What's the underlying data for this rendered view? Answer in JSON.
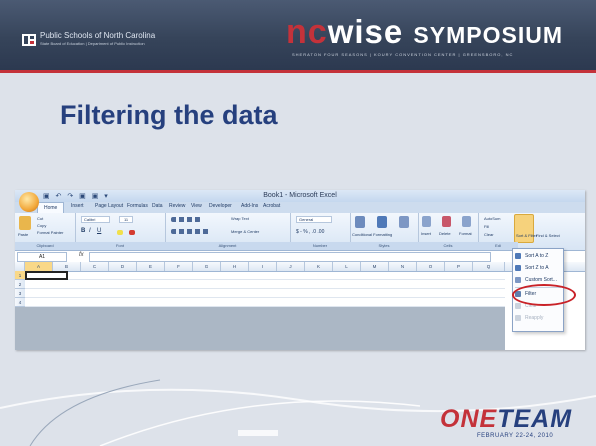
{
  "header": {
    "org_title": "Public Schools of North Carolina",
    "org_subtitle": "State Board of Education | Department of Public Instruction",
    "brand_nc": "nc",
    "brand_wise": "wise",
    "brand_symposium": "SYMPOSIUM",
    "venue": "SHERATON FOUR SEASONS  |  KOURY CONVENTION CENTER  |  GREENSBORO, NC"
  },
  "slide": {
    "title": "Filtering the data"
  },
  "excel": {
    "window_title": "Book1 - Microsoft Excel",
    "quick_access": "▣ ↶ ↷ ▣ ▣ ▾",
    "tabs": [
      "Home",
      "Insert",
      "Page Layout",
      "Formulas",
      "Data",
      "Review",
      "View",
      "Developer",
      "Add-Ins",
      "Acrobat"
    ],
    "ribbon_groups": {
      "clipboard": "Clipboard",
      "font": "Font",
      "alignment": "Alignment",
      "number": "Number",
      "styles": "Styles",
      "cells": "Cells",
      "editing": "Edi"
    },
    "ribbon_text": {
      "paste": "Paste",
      "cut": "Cut",
      "copy": "Copy",
      "format_painter": "Format Painter",
      "font_name": "Calibri",
      "font_size": "11",
      "wrap_text": "Wrap Text",
      "merge_center": "Merge & Center",
      "number_format": "General",
      "conditional": "Conditional Formatting",
      "format_table": "Format as Table",
      "cell_styles": "Cell Styles",
      "insert": "Insert",
      "delete": "Delete",
      "format": "Format",
      "autosum": "AutoSum",
      "fill": "Fill",
      "clear": "Clear",
      "sort_filter": "Sort & Filter",
      "find_select": "Find & Select"
    },
    "name_box": "A1",
    "fx": "fx",
    "columns": [
      "A",
      "B",
      "C",
      "D",
      "E",
      "F",
      "G",
      "H",
      "I",
      "J",
      "K",
      "L",
      "M",
      "N",
      "O",
      "P",
      "Q"
    ],
    "rows": [
      "1",
      "2",
      "3",
      "4"
    ],
    "sort_menu": [
      {
        "label": "Sort A to Z",
        "enabled": true
      },
      {
        "label": "Sort Z to A",
        "enabled": true
      },
      {
        "label": "Custom Sort...",
        "enabled": true
      },
      {
        "label": "Filter",
        "enabled": true,
        "highlighted": true
      },
      {
        "label": "Clear",
        "enabled": false
      },
      {
        "label": "Reapply",
        "enabled": false
      }
    ]
  },
  "footer": {
    "one": "ONE",
    "team": "TEAM",
    "dates": "FEBRUARY 22-24, 2010"
  },
  "colors": {
    "accent_red": "#c4323a",
    "title_blue": "#26407e",
    "header_bg": "#36445a",
    "slide_bg": "#dde2ea"
  }
}
